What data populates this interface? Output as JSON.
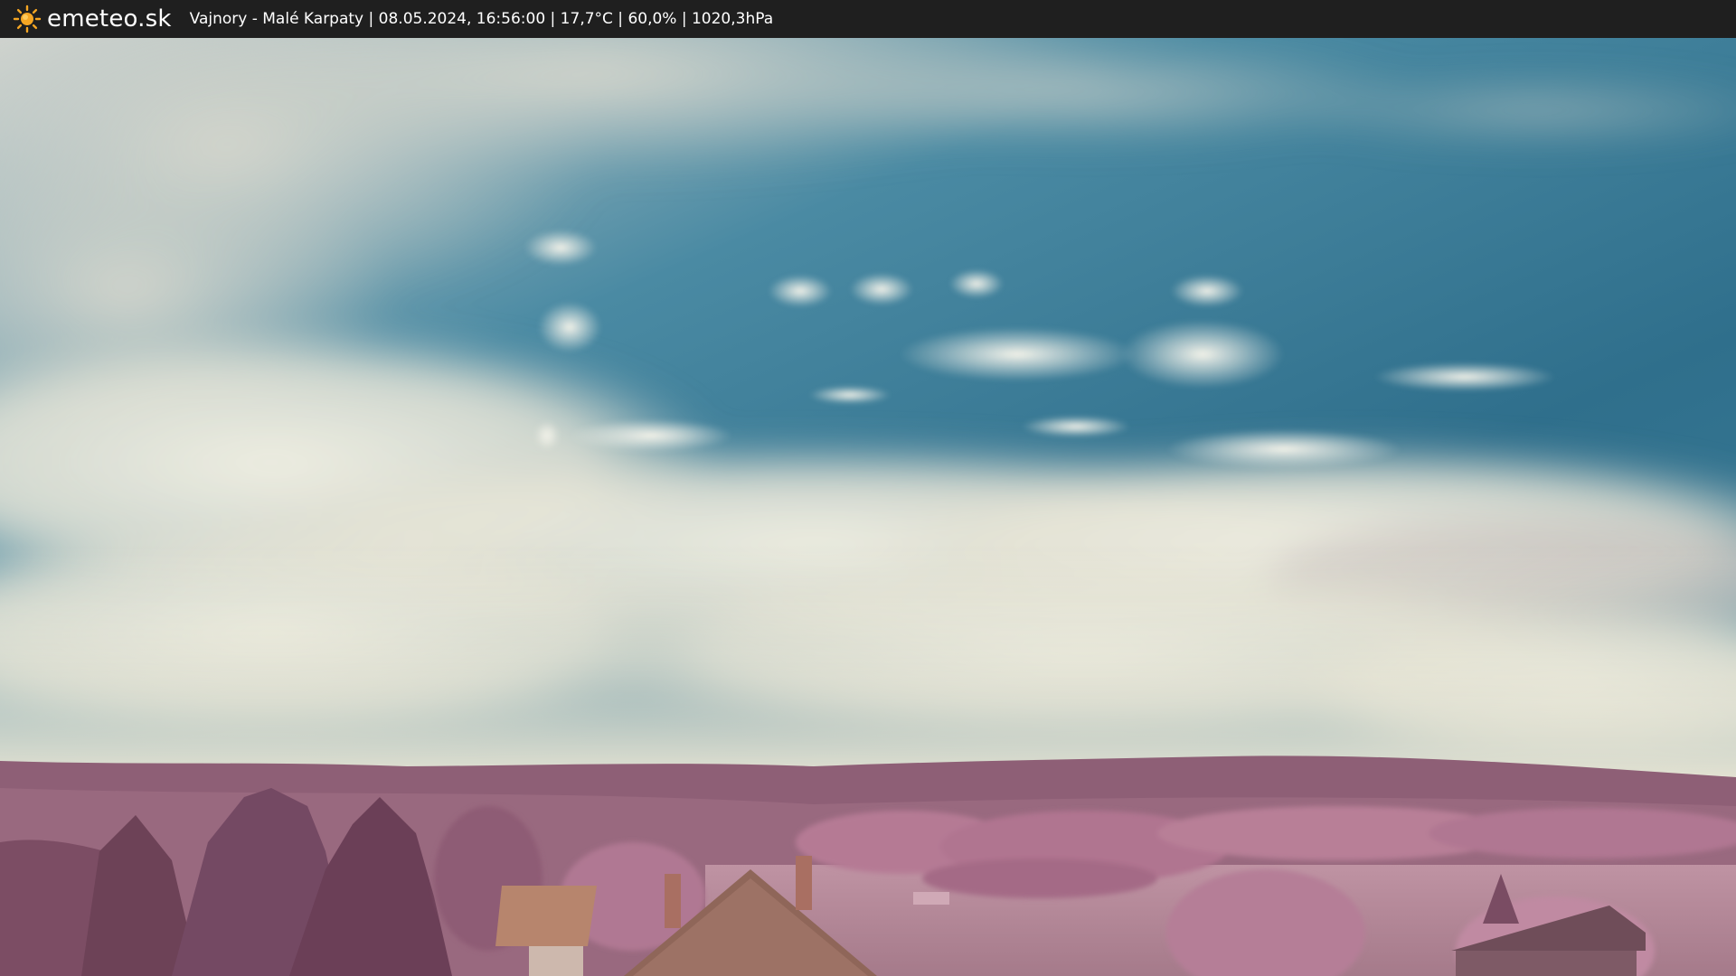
{
  "header": {
    "brand": "emeteo.sk",
    "info": "Vajnory - Malé Karpaty | 08.05.2024, 16:56:00 | 17,7°C | 60,0% | 1020,3hPa",
    "logo_icon": "sun-icon"
  },
  "colors": {
    "bar": "#1f1f1f",
    "sun": "#f5a623",
    "sky_blue": "#3f7f99",
    "cloud": "#e6e4d4",
    "hills": "#8a5a72",
    "foliage": "#b5758f"
  }
}
